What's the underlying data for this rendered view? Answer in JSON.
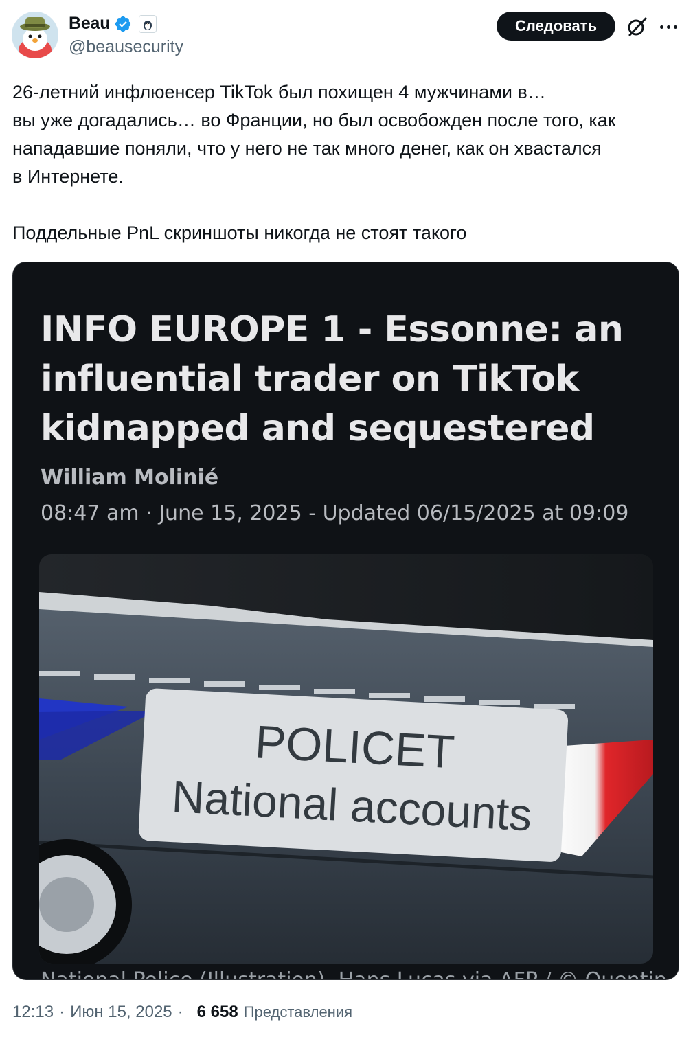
{
  "author": {
    "display_name": "Beau",
    "handle": "@beausecurity",
    "verified": true,
    "affiliate_badge": "penguin-badge-icon"
  },
  "actions": {
    "follow_label": "Следовать",
    "grok_icon": "grok-icon",
    "more_icon": "more-icon"
  },
  "tweet": {
    "lines": [
      "26-летний инфлюенсер TikTok был похищен 4 мужчинами в…",
      "вы уже догадались… во Франции, но был освобожден после того, как",
      "нападавшие поняли, что у него не так много денег, как он хвастался",
      "в Интернете."
    ],
    "second_paragraph": "Поддельные PnL скриншоты никогда не стоят такого"
  },
  "media": {
    "headline": "INFO EUROPE 1 - Essonne: an influential trader on TikTok kidnapped and sequestered",
    "author": "William Molinié",
    "dateline": "08:47 am · June 15, 2025 - Updated 06/15/2025 at 09:09",
    "photo_sign_line1": "POLICET",
    "photo_sign_line2": "National accounts",
    "caption": "National Police (Illustration). Hans Lucas via AFP / © Quentin"
  },
  "footer": {
    "time": "12:13",
    "date": "Июн 15, 2025",
    "views_count": "6 658",
    "views_label": "Представления"
  },
  "colors": {
    "follow_bg": "#0f1419",
    "verified_blue": "#1d9bf0",
    "muted": "#536471",
    "card_bg": "#0f1216"
  }
}
